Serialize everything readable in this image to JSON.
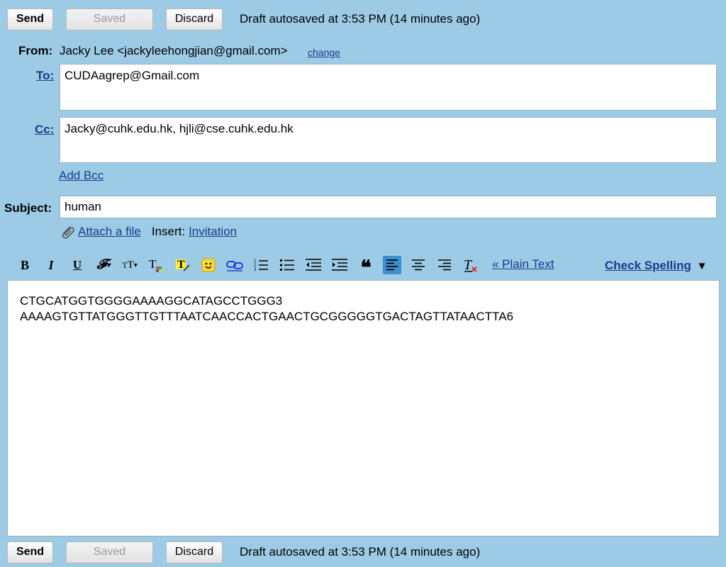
{
  "top_bar": {
    "send_label": "Send",
    "saved_label": "Saved",
    "discard_label": "Discard",
    "autosave_text": "Draft autosaved at 3:53 PM (14 minutes ago)"
  },
  "bottom_bar": {
    "send_label": "Send",
    "saved_label": "Saved",
    "discard_label": "Discard",
    "autosave_text": "Draft autosaved at 3:53 PM (14 minutes ago)"
  },
  "from": {
    "label": "From:",
    "value": "Jacky Lee <jackyleehongjian@gmail.com>",
    "change_link": "change"
  },
  "to": {
    "label": "To:",
    "value": "CUDAagrep@Gmail.com"
  },
  "cc": {
    "label": "Cc:",
    "value": "Jacky@cuhk.edu.hk, hjli@cse.cuhk.edu.hk"
  },
  "add_bcc": "Add Bcc",
  "subject": {
    "label": "Subject:",
    "value": "human"
  },
  "attach": {
    "attach_link": "Attach a file",
    "insert_label": "Insert:",
    "invitation_link": "Invitation"
  },
  "toolbar": {
    "plain_text_link": "« Plain Text",
    "check_spelling": "Check Spelling",
    "check_spelling_arrow": "▼",
    "icons": [
      "bold-icon",
      "italic-icon",
      "underline-icon",
      "font-icon",
      "font-size-icon",
      "text-color-icon",
      "highlight-icon",
      "emoticon-icon",
      "link-icon",
      "numbered-list-icon",
      "bullet-list-icon",
      "indent-less-icon",
      "indent-more-icon",
      "quote-icon",
      "align-left-icon",
      "align-center-icon",
      "align-right-icon",
      "remove-formatting-icon"
    ]
  },
  "body": {
    "line1": "CTGCATGGTGGGGAAAAGGCATAGCCTGGG3",
    "line2": "AAAAGTGTTATGGGTTGTTTAATCAACCACTGAACTGCGGGGGTGACTAGTTATAACTTA6"
  }
}
